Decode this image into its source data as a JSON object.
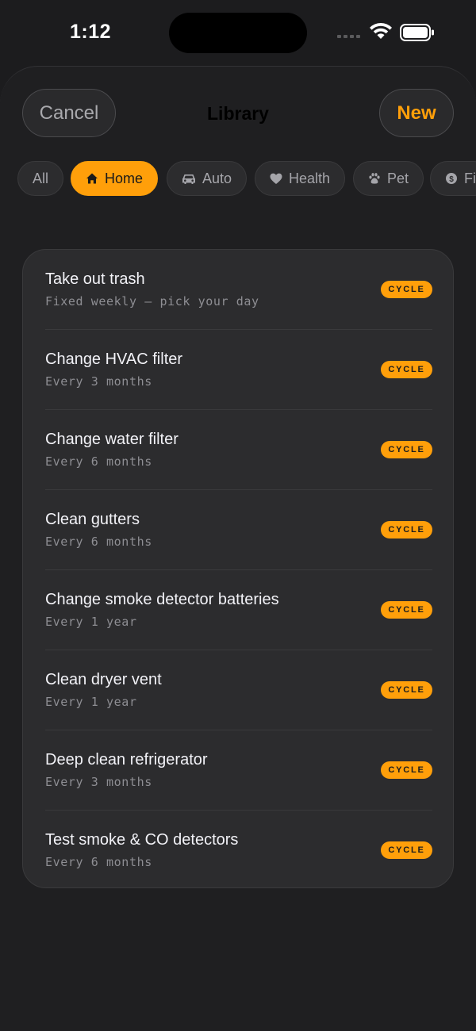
{
  "status": {
    "time": "1:12"
  },
  "nav": {
    "cancel_label": "Cancel",
    "title": "Library",
    "new_label": "New"
  },
  "chips": [
    {
      "label": "All",
      "icon": "none",
      "active": false
    },
    {
      "label": "Home",
      "icon": "house-icon",
      "active": true
    },
    {
      "label": "Auto",
      "icon": "car-icon",
      "active": false
    },
    {
      "label": "Health",
      "icon": "heart-icon",
      "active": false
    },
    {
      "label": "Pet",
      "icon": "paw-icon",
      "active": false
    },
    {
      "label": "Fi",
      "icon": "dollar-coin-icon",
      "active": false
    }
  ],
  "badge_label": "CYCLE",
  "colors": {
    "accent": "#ff9f0a",
    "background": "#1c1c1e",
    "card": "#2c2c2e"
  },
  "items": [
    {
      "title": "Take out trash",
      "subtitle": "Fixed weekly — pick your day"
    },
    {
      "title": "Change HVAC filter",
      "subtitle": "Every 3 months"
    },
    {
      "title": "Change water filter",
      "subtitle": "Every 6 months"
    },
    {
      "title": "Clean gutters",
      "subtitle": "Every 6 months"
    },
    {
      "title": "Change smoke detector batteries",
      "subtitle": "Every 1 year"
    },
    {
      "title": "Clean dryer vent",
      "subtitle": "Every 1 year"
    },
    {
      "title": "Deep clean refrigerator",
      "subtitle": "Every 3 months"
    },
    {
      "title": "Test smoke & CO detectors",
      "subtitle": "Every 6 months"
    }
  ]
}
